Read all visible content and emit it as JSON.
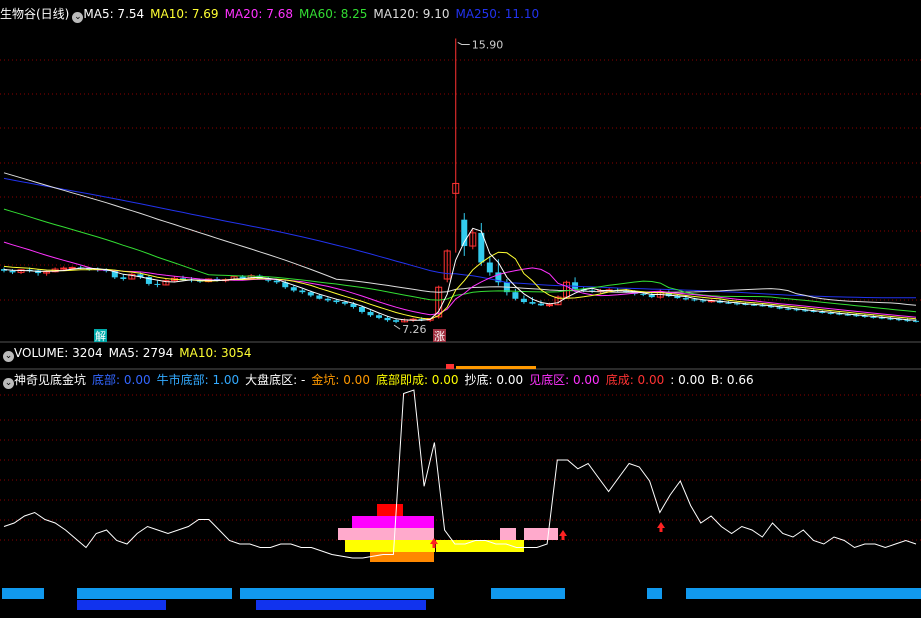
{
  "header": {
    "title": "生物谷(日线)",
    "ma_items": [
      {
        "label": "MA5: ",
        "value": "7.54",
        "color": "#ffffff"
      },
      {
        "label": "MA10: ",
        "value": "7.69",
        "color": "#ffff33"
      },
      {
        "label": "MA20: ",
        "value": "7.68",
        "color": "#ff33ff"
      },
      {
        "label": "MA60: ",
        "value": "8.25",
        "color": "#33dd33"
      },
      {
        "label": "MA120: ",
        "value": "9.10",
        "color": "#dddddd"
      },
      {
        "label": "MA250: ",
        "value": "11.10",
        "color": "#2233ee"
      }
    ],
    "high_label": "15.90",
    "low_label": "7.26",
    "jie_badge": "解",
    "zhang_badge": "涨"
  },
  "volume": {
    "title": "VOLUME: ",
    "value": "3204",
    "items": [
      {
        "label": "MA5: ",
        "value": "2794",
        "color": "#ffffff"
      },
      {
        "label": "MA10: ",
        "value": "3054",
        "color": "#ffff33"
      }
    ]
  },
  "indicator": {
    "title": "神奇见底金坑",
    "items": [
      {
        "label": "底部: ",
        "value": "0.00",
        "color": "#3366ff"
      },
      {
        "label": "牛市底部: ",
        "value": "1.00",
        "color": "#33aaff"
      },
      {
        "label": "大盘底区: ",
        "value": "-",
        "color": "#ffffff"
      },
      {
        "label": "金坑: ",
        "value": "0.00",
        "color": "#ff9900"
      },
      {
        "label": "底部即成: ",
        "value": "0.00",
        "color": "#ffff00"
      },
      {
        "label": "抄底: ",
        "value": "0.00",
        "color": "#ffffff"
      },
      {
        "label": "见底区: ",
        "value": "0.00",
        "color": "#ff33ff"
      },
      {
        "label": "底成: ",
        "value": "0.00",
        "color": "#ff3333"
      },
      {
        "label": ": ",
        "value": "0.00",
        "color": "#ffffff"
      },
      {
        "label": "B: ",
        "value": "0.66",
        "color": "#ffffff"
      }
    ]
  },
  "colors": {
    "up": "#ff3333",
    "down": "#33ccee",
    "grid": "#8b0000",
    "ma5": "#ffffff",
    "ma10": "#ffff33",
    "ma20": "#ff33ff",
    "ma60": "#33dd33",
    "ma120": "#dddddd",
    "ma250": "#2233ee"
  },
  "chart_data": {
    "type": "candlestick",
    "candles": [
      [
        8.9,
        8.95,
        8.8,
        8.85
      ],
      [
        8.85,
        8.9,
        8.75,
        8.8
      ],
      [
        8.8,
        8.9,
        8.75,
        8.88
      ],
      [
        8.88,
        8.95,
        8.8,
        8.86
      ],
      [
        8.86,
        8.9,
        8.7,
        8.78
      ],
      [
        8.78,
        8.85,
        8.7,
        8.82
      ],
      [
        8.82,
        8.95,
        8.8,
        8.9
      ],
      [
        8.9,
        8.98,
        8.85,
        8.93
      ],
      [
        8.93,
        8.98,
        8.88,
        8.95
      ],
      [
        8.95,
        9.0,
        8.9,
        8.92
      ],
      [
        8.92,
        8.96,
        8.85,
        8.9
      ],
      [
        8.9,
        8.95,
        8.82,
        8.88
      ],
      [
        8.88,
        8.92,
        8.8,
        8.84
      ],
      [
        8.84,
        8.88,
        8.6,
        8.65
      ],
      [
        8.65,
        8.75,
        8.55,
        8.6
      ],
      [
        8.6,
        8.78,
        8.58,
        8.74
      ],
      [
        8.74,
        8.8,
        8.6,
        8.66
      ],
      [
        8.66,
        8.72,
        8.4,
        8.45
      ],
      [
        8.45,
        8.55,
        8.35,
        8.42
      ],
      [
        8.42,
        8.6,
        8.4,
        8.55
      ],
      [
        8.55,
        8.68,
        8.5,
        8.62
      ],
      [
        8.62,
        8.7,
        8.55,
        8.58
      ],
      [
        8.58,
        8.66,
        8.5,
        8.55
      ],
      [
        8.55,
        8.6,
        8.48,
        8.52
      ],
      [
        8.52,
        8.62,
        8.5,
        8.6
      ],
      [
        8.6,
        8.66,
        8.52,
        8.55
      ],
      [
        8.55,
        8.62,
        8.5,
        8.58
      ],
      [
        8.58,
        8.7,
        8.55,
        8.67
      ],
      [
        8.67,
        8.72,
        8.6,
        8.62
      ],
      [
        8.62,
        8.75,
        8.6,
        8.7
      ],
      [
        8.7,
        8.74,
        8.58,
        8.6
      ],
      [
        8.6,
        8.66,
        8.5,
        8.55
      ],
      [
        8.55,
        8.6,
        8.45,
        8.5
      ],
      [
        8.5,
        8.55,
        8.3,
        8.35
      ],
      [
        8.35,
        8.4,
        8.2,
        8.25
      ],
      [
        8.25,
        8.3,
        8.15,
        8.2
      ],
      [
        8.2,
        8.25,
        8.05,
        8.1
      ],
      [
        8.1,
        8.15,
        7.98,
        8.0
      ],
      [
        8.0,
        8.05,
        7.9,
        7.95
      ],
      [
        7.95,
        8.0,
        7.85,
        7.9
      ],
      [
        7.9,
        7.95,
        7.8,
        7.85
      ],
      [
        7.85,
        7.9,
        7.7,
        7.75
      ],
      [
        7.75,
        7.8,
        7.55,
        7.6
      ],
      [
        7.6,
        7.65,
        7.45,
        7.5
      ],
      [
        7.5,
        7.55,
        7.38,
        7.42
      ],
      [
        7.42,
        7.48,
        7.3,
        7.35
      ],
      [
        7.35,
        7.4,
        7.26,
        7.3
      ],
      [
        7.3,
        7.4,
        7.28,
        7.36
      ],
      [
        7.36,
        7.42,
        7.3,
        7.38
      ],
      [
        7.38,
        7.44,
        7.32,
        7.35
      ],
      [
        7.35,
        7.42,
        7.3,
        7.4
      ],
      [
        7.45,
        8.4,
        7.4,
        8.35
      ],
      [
        8.6,
        9.5,
        8.5,
        9.45
      ],
      [
        11.2,
        15.9,
        9.4,
        11.5
      ],
      [
        10.4,
        10.6,
        9.3,
        9.6
      ],
      [
        9.6,
        10.1,
        9.5,
        10.0
      ],
      [
        10.0,
        10.3,
        9.0,
        9.1
      ],
      [
        9.1,
        9.3,
        8.7,
        8.8
      ],
      [
        8.8,
        9.2,
        8.4,
        8.5
      ],
      [
        8.5,
        8.6,
        8.1,
        8.2
      ],
      [
        8.2,
        8.3,
        7.95,
        8.0
      ],
      [
        8.0,
        8.1,
        7.85,
        7.9
      ],
      [
        7.9,
        8.05,
        7.82,
        7.85
      ],
      [
        7.85,
        7.95,
        7.78,
        7.8
      ],
      [
        7.8,
        7.88,
        7.75,
        7.82
      ],
      [
        7.82,
        8.1,
        7.8,
        8.05
      ],
      [
        8.05,
        8.55,
        8.0,
        8.5
      ],
      [
        8.5,
        8.65,
        8.2,
        8.3
      ],
      [
        8.3,
        8.35,
        8.2,
        8.25
      ],
      [
        8.25,
        8.3,
        8.18,
        8.22
      ],
      [
        8.22,
        8.3,
        8.15,
        8.25
      ],
      [
        8.25,
        8.32,
        8.2,
        8.27
      ],
      [
        8.27,
        8.32,
        8.2,
        8.24
      ],
      [
        8.24,
        8.3,
        8.18,
        8.2
      ],
      [
        8.2,
        8.26,
        8.1,
        8.15
      ],
      [
        8.15,
        8.22,
        8.08,
        8.12
      ],
      [
        8.12,
        8.18,
        8.02,
        8.05
      ],
      [
        8.05,
        8.28,
        8.0,
        8.2
      ],
      [
        8.2,
        8.25,
        8.05,
        8.08
      ],
      [
        8.08,
        8.12,
        8.0,
        8.02
      ],
      [
        8.02,
        8.06,
        7.95,
        7.98
      ],
      [
        7.98,
        8.03,
        7.92,
        7.95
      ],
      [
        7.95,
        8.0,
        7.88,
        7.92
      ],
      [
        7.92,
        7.98,
        7.88,
        7.94
      ],
      [
        7.94,
        7.98,
        7.86,
        7.88
      ],
      [
        7.88,
        7.93,
        7.84,
        7.86
      ],
      [
        7.86,
        7.9,
        7.8,
        7.84
      ],
      [
        7.84,
        7.88,
        7.8,
        7.82
      ],
      [
        7.82,
        7.86,
        7.78,
        7.8
      ],
      [
        7.8,
        7.85,
        7.76,
        7.78
      ],
      [
        7.78,
        7.82,
        7.72,
        7.74
      ],
      [
        7.74,
        7.78,
        7.68,
        7.7
      ],
      [
        7.7,
        7.75,
        7.65,
        7.68
      ],
      [
        7.68,
        7.72,
        7.62,
        7.65
      ],
      [
        7.65,
        7.7,
        7.6,
        7.63
      ],
      [
        7.63,
        7.68,
        7.58,
        7.6
      ],
      [
        7.6,
        7.65,
        7.55,
        7.57
      ],
      [
        7.57,
        7.62,
        7.52,
        7.55
      ],
      [
        7.55,
        7.6,
        7.5,
        7.52
      ],
      [
        7.52,
        7.57,
        7.48,
        7.5
      ],
      [
        7.5,
        7.55,
        7.45,
        7.48
      ],
      [
        7.48,
        7.52,
        7.42,
        7.45
      ],
      [
        7.45,
        7.5,
        7.4,
        7.43
      ],
      [
        7.43,
        7.48,
        7.38,
        7.4
      ],
      [
        7.4,
        7.45,
        7.35,
        7.38
      ],
      [
        7.38,
        7.42,
        7.32,
        7.35
      ],
      [
        7.35,
        7.4,
        7.3,
        7.33
      ],
      [
        7.33,
        7.38,
        7.28,
        7.32
      ]
    ],
    "ma_lines": [
      {
        "name": "MA250",
        "values": [
          11.7,
          11.1
        ]
      },
      {
        "name": "MA120",
        "values": [
          11.9,
          10.5,
          9.1
        ]
      },
      {
        "name": "MA60",
        "values": [
          10.8,
          8.25
        ]
      },
      {
        "name": "MA20",
        "values": [
          9.8,
          7.68
        ]
      },
      {
        "name": "MA10",
        "values": [
          9.0,
          7.69
        ]
      },
      {
        "name": "MA5",
        "values": [
          8.9,
          7.54
        ]
      }
    ],
    "indicator_line": [
      0.22,
      0.24,
      0.28,
      0.3,
      0.26,
      0.24,
      0.2,
      0.15,
      0.1,
      0.18,
      0.2,
      0.14,
      0.12,
      0.18,
      0.22,
      0.2,
      0.18,
      0.2,
      0.22,
      0.26,
      0.26,
      0.2,
      0.14,
      0.12,
      0.12,
      0.1,
      0.1,
      0.12,
      0.12,
      0.1,
      0.1,
      0.08,
      0.06,
      0.05,
      0.04,
      0.04,
      0.05,
      0.06,
      0.06,
      0.98,
      1.0,
      0.45,
      0.7,
      0.2,
      0.12,
      0.12,
      0.14,
      0.14,
      0.12,
      0.12,
      0.1,
      0.1,
      0.1,
      0.12,
      0.6,
      0.6,
      0.55,
      0.58,
      0.5,
      0.42,
      0.5,
      0.58,
      0.56,
      0.48,
      0.3,
      0.4,
      0.48,
      0.34,
      0.24,
      0.28,
      0.22,
      0.18,
      0.22,
      0.2,
      0.16,
      0.24,
      0.18,
      0.16,
      0.2,
      0.14,
      0.12,
      0.16,
      0.14,
      0.1,
      0.12,
      0.12,
      0.1,
      0.12,
      0.14,
      0.12
    ]
  }
}
